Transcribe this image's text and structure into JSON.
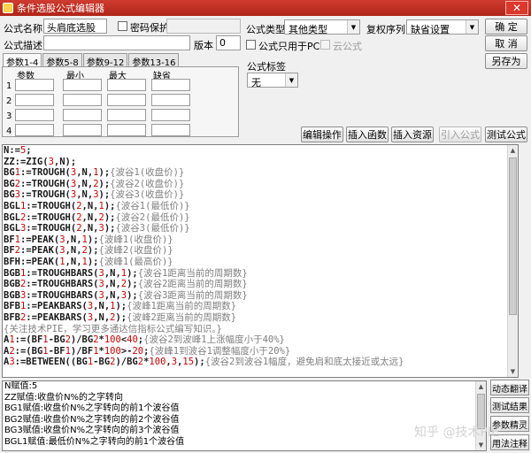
{
  "window": {
    "title": "条件选股公式编辑器",
    "close_glyph": "✕"
  },
  "form": {
    "name_label": "公式名称",
    "name_value": "头肩底选股",
    "password_label": "密码保护",
    "desc_label": "公式描述",
    "desc_value": "",
    "version_label": "版本",
    "version_value": "0",
    "type_label": "公式类型",
    "type_value": "其他类型",
    "rights_label": "复权序列",
    "rights_value": "缺省设置",
    "pc_only_label": "公式只用于PC",
    "cloud_label": "云公式",
    "tag_label": "公式标签",
    "tag_value": "无"
  },
  "buttons": {
    "ok": "确  定",
    "cancel": "取  消",
    "save_as": "另存为",
    "edit_ops": "编辑操作",
    "insert_func": "插入函数",
    "insert_res": "插入资源",
    "import": "引入公式",
    "test": "测试公式"
  },
  "param_tabs": [
    "参数1-4",
    "参数5-8",
    "参数9-12",
    "参数13-16"
  ],
  "param_headers": [
    "参数",
    "最小",
    "最大",
    "缺省"
  ],
  "param_rows": [
    "1",
    "2",
    "3",
    "4"
  ],
  "code_lines": [
    "N:=5;",
    "ZZ:=ZIG(3,N);",
    "BG1:=TROUGH(3,N,1);{波谷1(收盘价)}",
    "BG2:=TROUGH(3,N,2);{波谷2(收盘价)}",
    "BG3:=TROUGH(3,N,3);{波谷3(收盘价)}",
    "BGL1:=TROUGH(2,N,1);{波谷1(最低价)}",
    "BGL2:=TROUGH(2,N,2);{波谷2(最低价)}",
    "BGL3:=TROUGH(2,N,3);{波谷3(最低价)}",
    "BF1:=PEAK(3,N,1);{波峰1(收盘价)}",
    "BF2:=PEAK(3,N,2);{波峰2(收盘价)}",
    "BFH:=PEAK(1,N,1);{波峰1(最高价)}",
    "BGB1:=TROUGHBARS(3,N,1);{波谷1距离当前的周期数}",
    "BGB2:=TROUGHBARS(3,N,2);{波谷2距离当前的周期数}",
    "BGB3:=TROUGHBARS(3,N,3);{波谷3距离当前的周期数}",
    "BFB1:=PEAKBARS(3,N,1);{波峰1距离当前的周期数}",
    "BFB2:=PEAKBARS(3,N,2);{波峰2距离当前的周期数}",
    "{关注技术PIE，学习更多通达信指标公式编写知识。}",
    "A1:=(BF1-BG2)/BG2*100<40;{波谷2到波峰1上涨幅度小于40%}",
    "A2:=(BG1-BF1)/BF1*100>-20;{波峰1到波谷1调整幅度小于20%}",
    "A3:=BETWEEN((BG1-BG2)/BG2*100,3,15);{波谷2到波谷1幅度，避免肩和底太接近或太远}"
  ],
  "output_lines": [
    "N赋值:5",
    "ZZ赋值:收盘价N%的之字转向",
    "BG1赋值:收盘价N%之字转向的前1个波谷值",
    "BG2赋值:收盘价N%之字转向的前2个波谷值",
    "BG3赋值:收盘价N%之字转向的前3个波谷值",
    "BGL1赋值:最低价N%之字转向的前1个波谷值"
  ],
  "side_buttons": [
    "动态翻译",
    "测试结果",
    "参数精灵",
    "用法注释"
  ],
  "watermark": "知乎 @技术PIE",
  "colors": {
    "titlebar": "#c0392b",
    "keyword": "#1a1a1a",
    "number": "#cc0000",
    "comment": "#808080"
  }
}
